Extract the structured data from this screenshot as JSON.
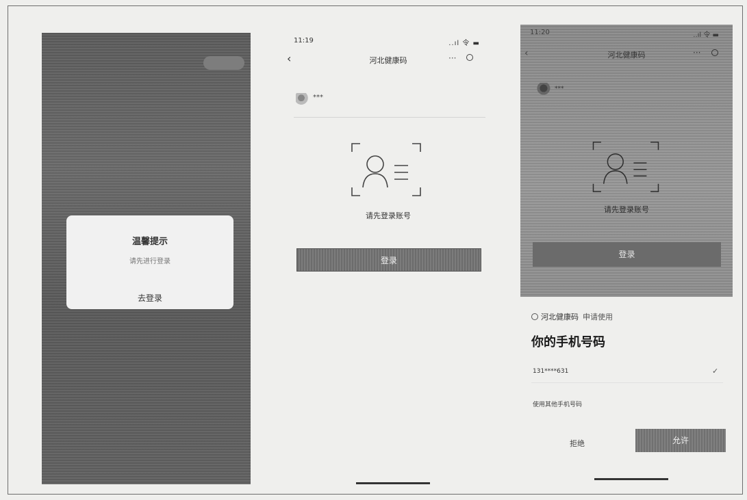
{
  "panel1": {
    "switch_label": "",
    "banner": "",
    "dialog": {
      "title": "温馨提示",
      "message": "请先进行登录",
      "button": "去登录"
    }
  },
  "panel2": {
    "status_time": "11:19",
    "status_signal": "..ıl 令 ▬",
    "back": "‹",
    "title": "河北健康码",
    "more": "···",
    "account_masked": "***",
    "hint": "请先登录账号",
    "login_button": "登录"
  },
  "panel3": {
    "status_time": "11:20",
    "status_signal": "..ıl 令 ▬",
    "back": "‹",
    "title": "河北健康码",
    "more": "···",
    "account_masked": "***",
    "hint": "请先登录账号",
    "login_button": "登录",
    "sheet": {
      "app_name": "河北健康码",
      "request": "申请使用",
      "heading": "你的手机号码",
      "phone": "131****631",
      "phone_sub": "",
      "check": "✓",
      "other_phone": "使用其他手机号码",
      "deny": "拒绝",
      "allow": "允许"
    }
  }
}
